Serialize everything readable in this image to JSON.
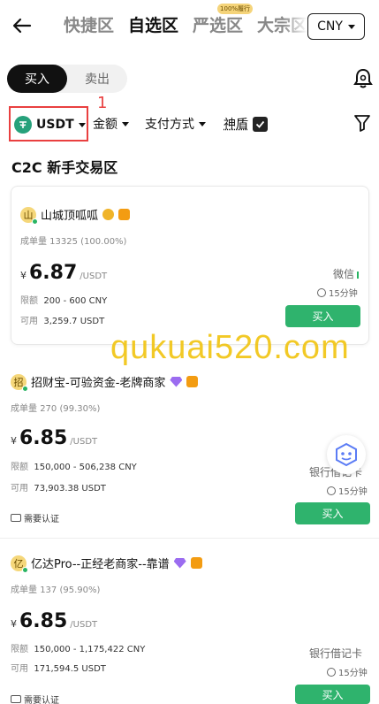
{
  "header": {
    "tabs": [
      {
        "label": "快捷区"
      },
      {
        "label": "自选区"
      },
      {
        "label": "严选区",
        "badge": "100%履行"
      },
      {
        "label": "大宗区"
      }
    ],
    "active_tab": "自选区",
    "currency": "CNY"
  },
  "trade_toggle": {
    "buy": "买入",
    "sell": "卖出"
  },
  "filters": {
    "coin": "USDT",
    "amount": "金额",
    "payment": "支付方式",
    "shield": "神盾",
    "step_marker": "1"
  },
  "section_title": "C2C 新手交易区",
  "listings": [
    {
      "name": "山城顶呱呱",
      "avatar": "山",
      "volume": "成单量 13325 (100.00%)",
      "price_cur": "¥",
      "price": "6.87",
      "price_unit": "/USDT",
      "limit_label": "限额",
      "limit": "200 - 600 CNY",
      "avail_label": "可用",
      "avail": "3,259.7 USDT",
      "payment": "微信",
      "time": "15分钟",
      "button": "买入"
    },
    {
      "name": "招财宝-可验资金-老牌商家",
      "avatar": "招",
      "volume_label": "成单量",
      "volume": "270 (99.30%)",
      "price_cur": "¥",
      "price": "6.85",
      "price_unit": "/USDT",
      "limit_label": "限额",
      "limit": "150,000 - 506,238 CNY",
      "avail_label": "可用",
      "avail": "73,903.38 USDT",
      "payment": "银行借记卡",
      "time": "15分钟",
      "kyc": "需要认证",
      "button": "买入"
    },
    {
      "name": "亿达Pro--正经老商家--靠谱",
      "avatar": "亿",
      "volume_label": "成单量",
      "volume": "137 (95.90%)",
      "price_cur": "¥",
      "price": "6.85",
      "price_unit": "/USDT",
      "limit_label": "限额",
      "limit": "150,000 - 1,175,422 CNY",
      "avail_label": "可用",
      "avail": "171,594.5 USDT",
      "payment": "银行借记卡",
      "time": "15分钟",
      "kyc": "需要认证",
      "button": "买入"
    }
  ],
  "watermark": "qukuai520.com",
  "colors": {
    "buy_green": "#2fb36d",
    "highlight_red": "#e94040",
    "watermark": "#f1c40f"
  }
}
